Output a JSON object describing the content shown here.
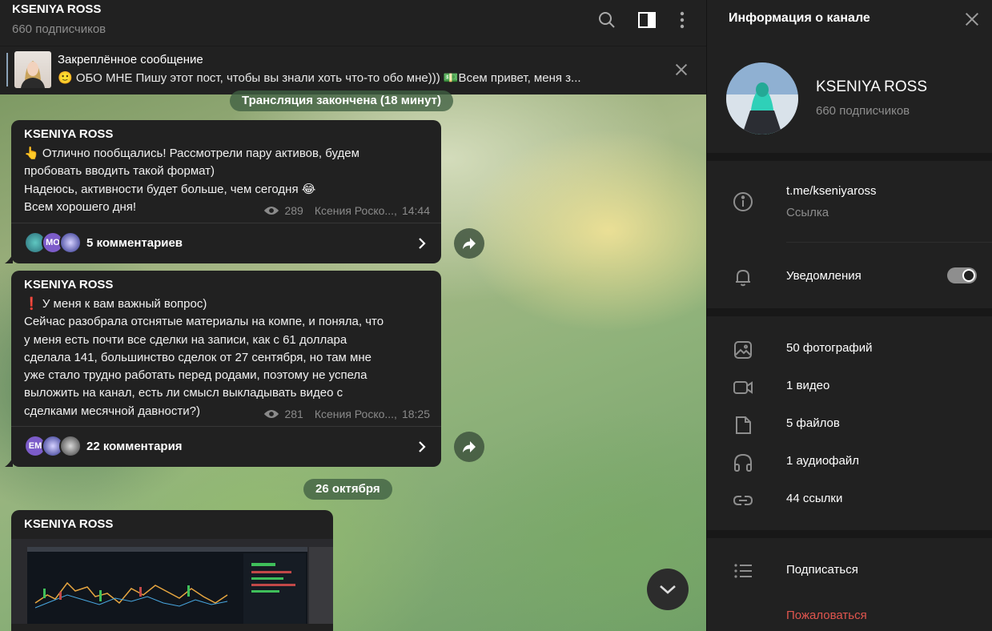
{
  "chat_header": {
    "title": "KSENIYA ROSS",
    "subtitle": "660 подписчиков"
  },
  "pinned": {
    "title": "Закреплённое сообщение",
    "text": "🙂 ОБО МНЕ  Пишу этот пост, чтобы вы знали хоть что-то обо мне))) 💵Всем привет, меня з..."
  },
  "service_pill_1": "Трансляция закончена (18 минут)",
  "messages": [
    {
      "author": "KSENIYA ROSS",
      "text": "👆 Отлично пообщались! Рассмотрели пару активов, будем\nпробовать вводить такой формат)\nНадеюсь, активности будет больше, чем сегодня 😂\nВсем хорошего дня!",
      "views": "289",
      "signature": "Ксения Роско...,",
      "time": "14:44",
      "comments": "5 комментариев",
      "avatars": [
        "",
        "MO",
        ""
      ]
    },
    {
      "author": "KSENIYA ROSS",
      "text": "❗ У меня к вам важный вопрос)\nСейчас разобрала отснятые материалы на компе, и поняла, что\nу меня есть почти все сделки на записи, как с 61 доллара\nсделала 141, большинство сделок от 27 сентября, но там мне\nуже стало трудно работать перед родами, поэтому не успела\nвыложить на канал, есть ли смысл выкладывать видео с\nсделками месячной давности?)",
      "views": "281",
      "signature": "Ксения Роско...,",
      "time": "18:25",
      "comments": "22 комментария",
      "avatars": [
        "EM",
        "",
        ""
      ]
    },
    {
      "author": "KSENIYA ROSS"
    }
  ],
  "date_pill": "26 октября",
  "info_panel": {
    "title": "Информация о канале",
    "name": "KSENIYA ROSS",
    "subs": "660 подписчиков",
    "link": "t.me/kseniyaross",
    "link_label": "Ссылка",
    "notifications": "Уведомления",
    "notifications_on": true,
    "media": [
      {
        "icon": "photo-icon",
        "label": "50 фотографий"
      },
      {
        "icon": "video-icon",
        "label": "1 видео"
      },
      {
        "icon": "file-icon",
        "label": "5 файлов"
      },
      {
        "icon": "headphones-icon",
        "label": "1 аудиофайл"
      },
      {
        "icon": "link-icon",
        "label": "44 ссылки"
      }
    ],
    "subscribe": "Подписаться",
    "report": "Пожаловаться"
  },
  "colors": {
    "panel_bg": "#212121",
    "accent_muted": "#8ba2b8",
    "report_red": "#e0554e",
    "pill_green": "#406042"
  }
}
